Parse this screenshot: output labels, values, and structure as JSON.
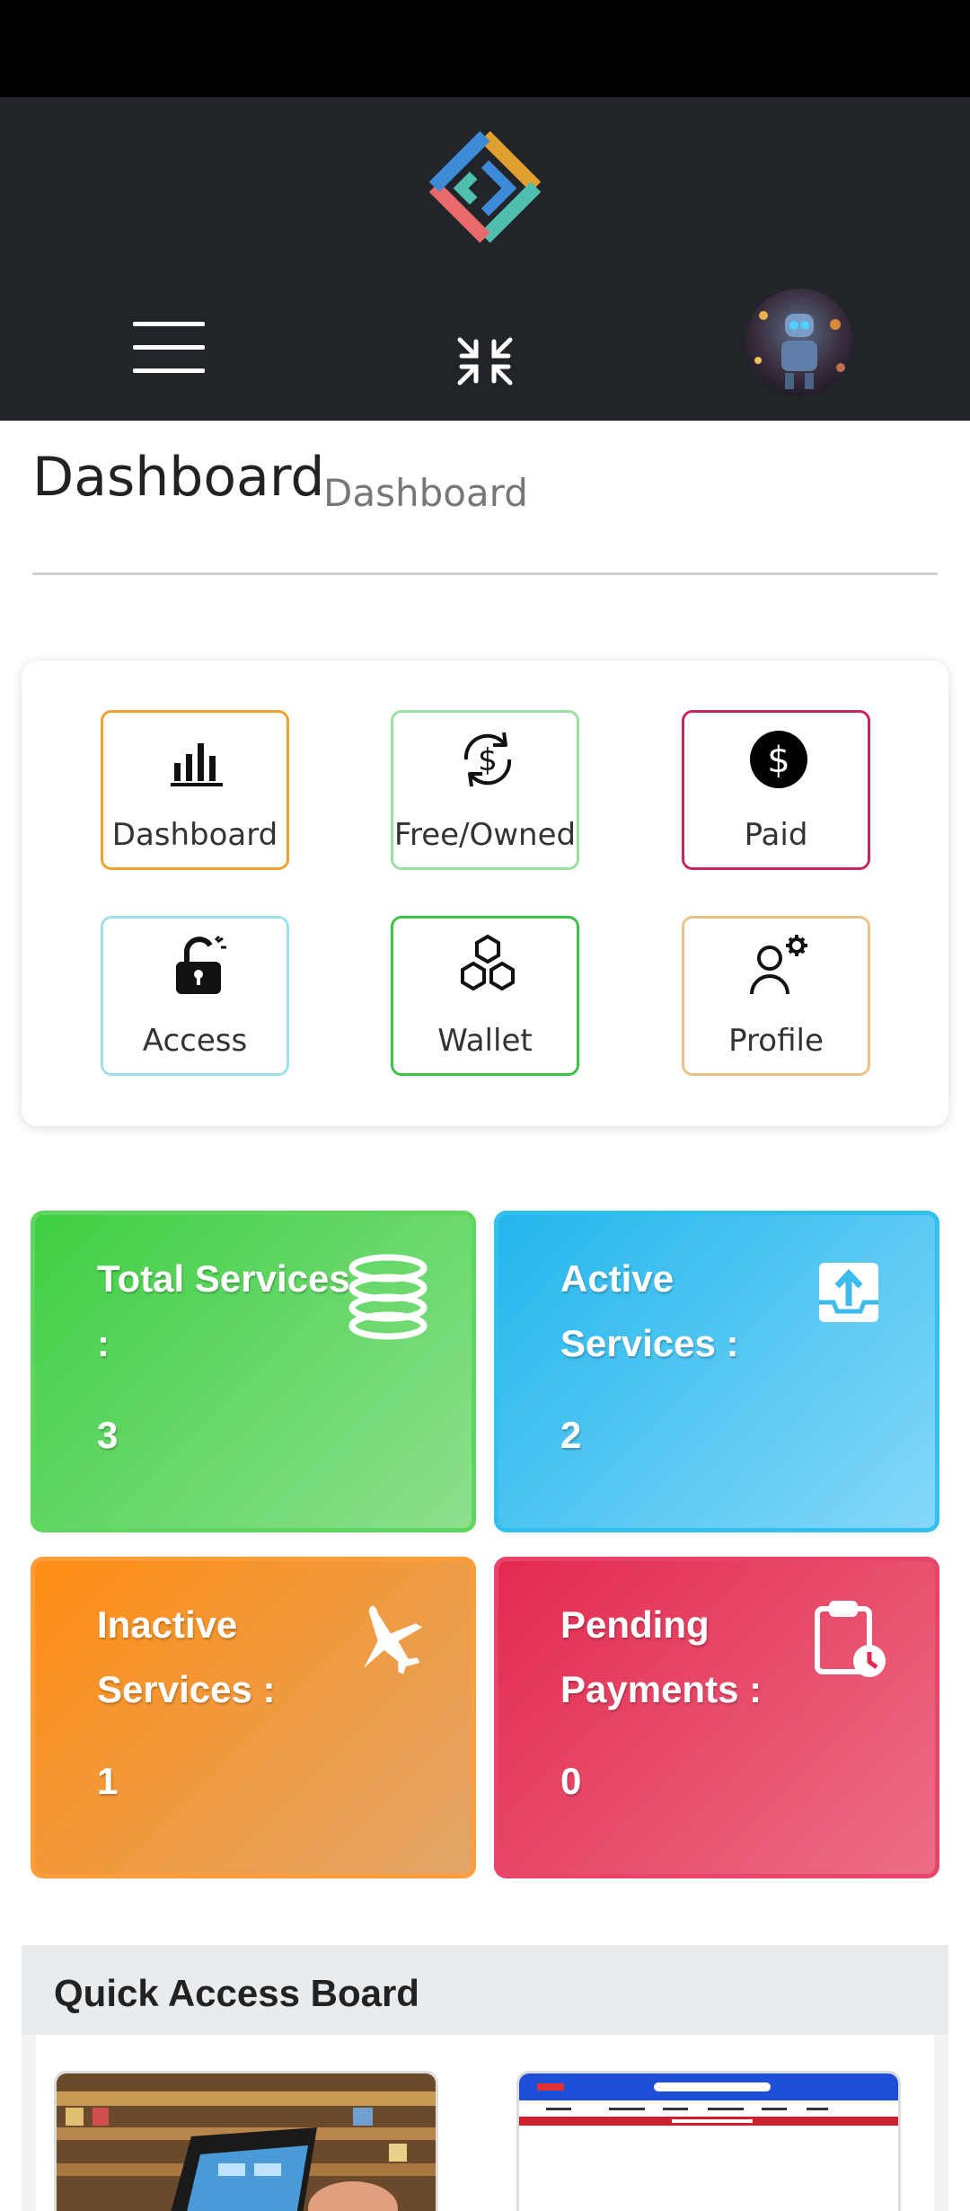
{
  "header": {
    "logo_icon": "brand-logo-icon",
    "menu_icon": "hamburger-menu-icon",
    "fullscreen_icon": "collapse-fullscreen-icon",
    "avatar_icon": "robot-avatar"
  },
  "page": {
    "title": "Dashboard",
    "breadcrumb": "Dashboard"
  },
  "quick_nav": [
    {
      "label": "Dashboard",
      "icon": "bar-chart-icon",
      "color": "#f0a030"
    },
    {
      "label": "Free/Owned",
      "icon": "dollar-refresh-icon",
      "color": "#9be0a0"
    },
    {
      "label": "Paid",
      "icon": "dollar-circle-icon",
      "color": "#c8275a"
    },
    {
      "label": "Access",
      "icon": "unlock-icon",
      "color": "#9fe0ef"
    },
    {
      "label": "Wallet",
      "icon": "hexagons-icon",
      "color": "#3ec24a"
    },
    {
      "label": "Profile",
      "icon": "user-gear-icon",
      "color": "#e8c383"
    }
  ],
  "stats": [
    {
      "label": "Total Services :",
      "value": "3",
      "icon": "database-icon",
      "color": "#3ecf43"
    },
    {
      "label": "Active Services :",
      "value": "2",
      "icon": "upload-tray-icon",
      "color": "#22b6ec"
    },
    {
      "label": "Inactive Services :",
      "value": "1",
      "icon": "airplane-icon",
      "color": "#ff8d13"
    },
    {
      "label": "Pending Payments :",
      "value": "0",
      "icon": "clipboard-clock-icon",
      "color": "#e3294f"
    }
  ],
  "quick_access": {
    "title": "Quick Access Board"
  }
}
